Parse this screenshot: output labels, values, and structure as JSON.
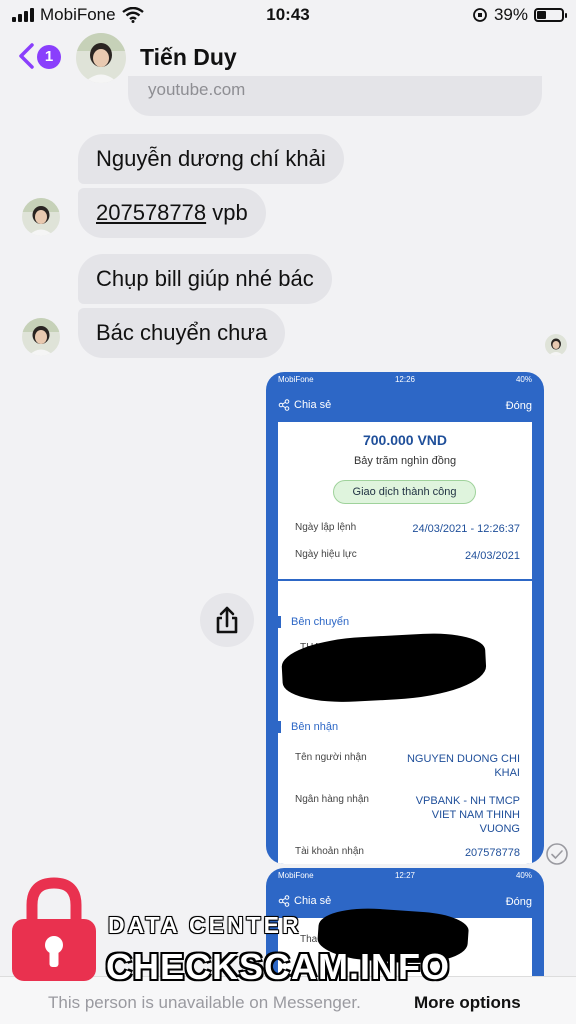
{
  "status_bar": {
    "carrier": "MobiFone",
    "time": "10:43",
    "battery": "39%"
  },
  "header": {
    "back_badge": "1",
    "contact_name": "Tiến Duy"
  },
  "messages": {
    "previous_link": "youtube.com",
    "m1": "Nguyễn dương chí khải",
    "m2_account": "207578778",
    "m2_bank": " vpb",
    "m3": "Chụp bill giúp nhé bác",
    "m4": "Bác chuyển chưa"
  },
  "receipt": {
    "status_carrier": "MobiFone",
    "status_time": "12:26",
    "status_battery": "40%",
    "share_label": "Chia sẻ",
    "close_label": "Đóng",
    "amount": "700.000 VND",
    "amount_words": "Bảy trăm nghìn đồng",
    "status_badge": "Giao dịch thành công",
    "created_label": "Ngày lập lệnh",
    "created_value": "24/03/2021 - 12:26:37",
    "effective_label": "Ngày hiệu lực",
    "effective_value": "24/03/2021",
    "sender_section": "Bên chuyển",
    "sender_partial": "THA",
    "receiver_section": "Bên nhận",
    "receiver_name_label": "Tên người nhận",
    "receiver_name_value": "NGUYEN DUONG CHI KHAI",
    "bank_label": "Ngân hàng nhận",
    "bank_value": "VPBANK - NH TMCP VIET NAM THINH VUONG",
    "account_label": "Tài khoản nhận",
    "account_value": "207578778"
  },
  "receipt2": {
    "status_carrier": "MobiFone",
    "status_time": "12:27",
    "status_battery": "40%",
    "share_label": "Chia sẻ",
    "close_label": "Đóng",
    "partial": "Tha"
  },
  "footer": {
    "unavailable_text": "This person is unavailable on Messenger.",
    "more_options": "More options"
  },
  "watermark": {
    "line1": "DATA CENTER",
    "line2": "CHECKSCAM.INFO"
  },
  "colors": {
    "accent": "#8a3ffc",
    "bubble": "#e4e4e8",
    "receipt_blue": "#2d67c6",
    "watermark_red": "#e9314f"
  }
}
